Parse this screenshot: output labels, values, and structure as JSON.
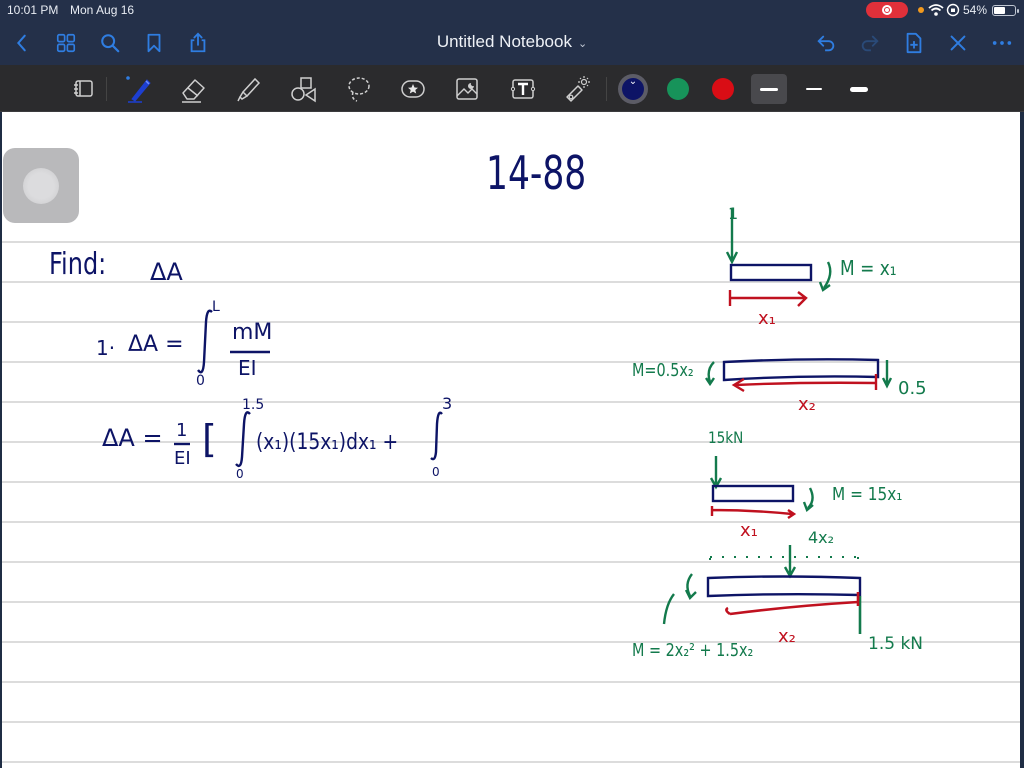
{
  "status_bar": {
    "time": "10:01 PM",
    "date": "Mon Aug 16",
    "battery_percent_label": "54%",
    "battery_level": 0.54,
    "recording": true
  },
  "nav_bar": {
    "title": "Untitled Notebook",
    "left_icons": [
      "back-icon",
      "grid-icon",
      "search-icon",
      "bookmark-icon",
      "share-icon"
    ],
    "right_icons": [
      "undo-icon",
      "redo-icon",
      "add-page-icon",
      "close-icon",
      "more-icon"
    ]
  },
  "toolbar": {
    "tools": [
      "page-view",
      "pen",
      "eraser",
      "highlighter",
      "shapes",
      "lasso",
      "sticker",
      "image",
      "text",
      "laser-pointer"
    ],
    "active_tool": "pen",
    "colors": [
      {
        "name": "navy",
        "hex": "#0d1466",
        "selected": true
      },
      {
        "name": "green",
        "hex": "#17935a",
        "selected": false
      },
      {
        "name": "red",
        "hex": "#d90d15",
        "selected": false
      }
    ],
    "stroke_widths": [
      "medium",
      "thin",
      "thick"
    ],
    "selected_stroke": "medium"
  },
  "notes": {
    "heading": "14-88",
    "find_label": "Find:",
    "find_target": "ΔA",
    "step1_prefix": "1·",
    "eq1_lhs": "ΔA =",
    "eq1_upper": "L",
    "eq1_lower": "0",
    "eq1_numerator": "mM",
    "eq1_denominator": "EI",
    "eq2_lhs": "ΔA =",
    "eq2_fraction_num": "1",
    "eq2_fraction_den": "EI",
    "eq2_bracket": "[",
    "eq2_int1_upper": "1.5",
    "eq2_int1_lower": "0",
    "eq2_int1_body": "(x₁)(15x₁)dx₁ +",
    "eq2_int2_upper": "3",
    "eq2_int2_lower": "0"
  },
  "diagrams": {
    "d1": {
      "load": "1",
      "moment": "M = x₁",
      "coord": "x₁"
    },
    "d2": {
      "moment": "M=0.5x₂",
      "reaction": "0.5",
      "coord": "x₂"
    },
    "d3": {
      "load": "15kN",
      "moment": "M = 15x₁",
      "coord": "x₁"
    },
    "d4": {
      "dist_load": "4x₂",
      "moment": "M = 2x₂² + 1.5x₂",
      "reaction": "1.5 kN",
      "coord": "x₂"
    }
  }
}
